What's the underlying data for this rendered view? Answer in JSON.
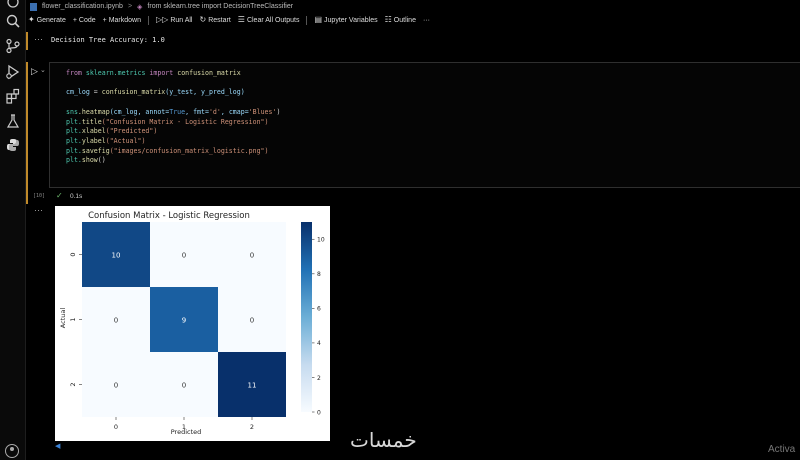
{
  "breadcrumb": {
    "file": "flower_classification.ipynb",
    "separator": ">",
    "symbol": "from sklearn.tree import DecisionTreeClassifier"
  },
  "toolbar": {
    "generate": "Generate",
    "code": "+ Code",
    "markdown": "+ Markdown",
    "run_all": "Run All",
    "restart": "Restart",
    "clear_outputs": "Clear All Outputs",
    "variables": "Jupyter Variables",
    "outline": "Outline",
    "more": "···"
  },
  "output_1": {
    "dots": "···",
    "text": "Decision Tree Accuracy: 1.0"
  },
  "cell": {
    "execution_count": "[10]",
    "status_time": "0.1s",
    "lines": {
      "l1_kw1": "from",
      "l1_mod": "sklearn.metrics",
      "l1_kw2": "import",
      "l1_fn": "confusion_matrix",
      "l3_var": "cm_log",
      "l3_eq": " = ",
      "l3_fn": "confusion_matrix",
      "l3_args": "(y_test, y_pred_log)",
      "l5_mod": "sns",
      "l5_fn": ".heatmap",
      "l5_a": "(cm_log, annot=",
      "l5_true": "True",
      "l5_b": ", fmt=",
      "l5_fmt": "'d'",
      "l5_c": ", cmap=",
      "l5_cmap": "'Blues'",
      "l5_d": ")",
      "l6_a": "plt.",
      "l6_fn": "title",
      "l6_s": "(\"Confusion Matrix - Logistic Regression\")",
      "l7_a": "plt.",
      "l7_fn": "xlabel",
      "l7_s": "(\"Predicted\")",
      "l8_a": "plt.",
      "l8_fn": "ylabel",
      "l8_s": "(\"Actual\")",
      "l9_a": "plt.",
      "l9_fn": "savefig",
      "l9_s": "(\"images/confusion_matrix_logistic.png\")",
      "l10_a": "plt.",
      "l10_fn": "show",
      "l10_s": "()"
    }
  },
  "output_2": {
    "dots": "···"
  },
  "chart_data": {
    "type": "heatmap",
    "title": "Confusion Matrix - Logistic Regression",
    "xlabel": "Predicted",
    "ylabel": "Actual",
    "x_ticks": [
      "0",
      "1",
      "2"
    ],
    "y_ticks": [
      "0",
      "1",
      "2"
    ],
    "values": [
      [
        10,
        0,
        0
      ],
      [
        0,
        9,
        0
      ],
      [
        0,
        0,
        11
      ]
    ],
    "colorbar": {
      "min": 0,
      "max": 11,
      "ticks": [
        0,
        2,
        4,
        6,
        8,
        10
      ]
    },
    "cmap": "Blues"
  },
  "watermark": "خمسات",
  "activate_text": "Activa",
  "colors": {
    "accent_bar": "#c08a2a",
    "check": "#6cb66c"
  },
  "icons": [
    "explorer-icon",
    "search-icon",
    "source-control-icon",
    "run-debug-icon",
    "extensions-icon",
    "testing-icon",
    "python-icon",
    "account-icon"
  ]
}
